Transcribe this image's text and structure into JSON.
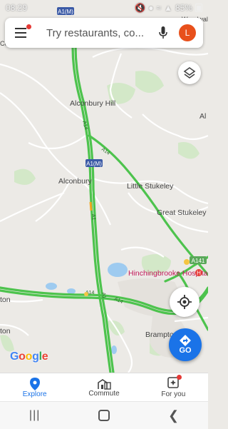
{
  "status": {
    "time": "08:29",
    "battery": "85%"
  },
  "search": {
    "placeholder": "Try restaurants, co...",
    "avatar_letter": "L"
  },
  "map": {
    "labels": {
      "alconbury_hill": "Alconbury Hill",
      "alconbury": "Alconbury",
      "little_stukeley": "Little Stukeley",
      "great_stukeley": "Great Stukeley",
      "hospital": "Hinchingbrooke Hospital",
      "brampton": "Brampton",
      "ton_left": "ton",
      "ton_left2": "ton",
      "woodwalton": "Woodwalton",
      "copping": "Copping",
      "al_right": "Al"
    },
    "road_shields": {
      "a1m_top": "A1(M)",
      "a1m_mid": "A1(M)",
      "a141": "A141"
    },
    "road_labels": {
      "a14_1": "A14",
      "a14_2": "A14",
      "a1": "A1",
      "a1_2": "A1",
      "a14_3": "A14",
      "a14_4": "A14"
    }
  },
  "go_label": "GO",
  "logo": "Google",
  "nav": {
    "explore": "Explore",
    "commute": "Commute",
    "for_you": "For you"
  },
  "colors": {
    "traffic_green": "#4dc34d",
    "accent_blue": "#1a73e8",
    "avatar": "#e8501b",
    "hospital": "#e53935"
  }
}
